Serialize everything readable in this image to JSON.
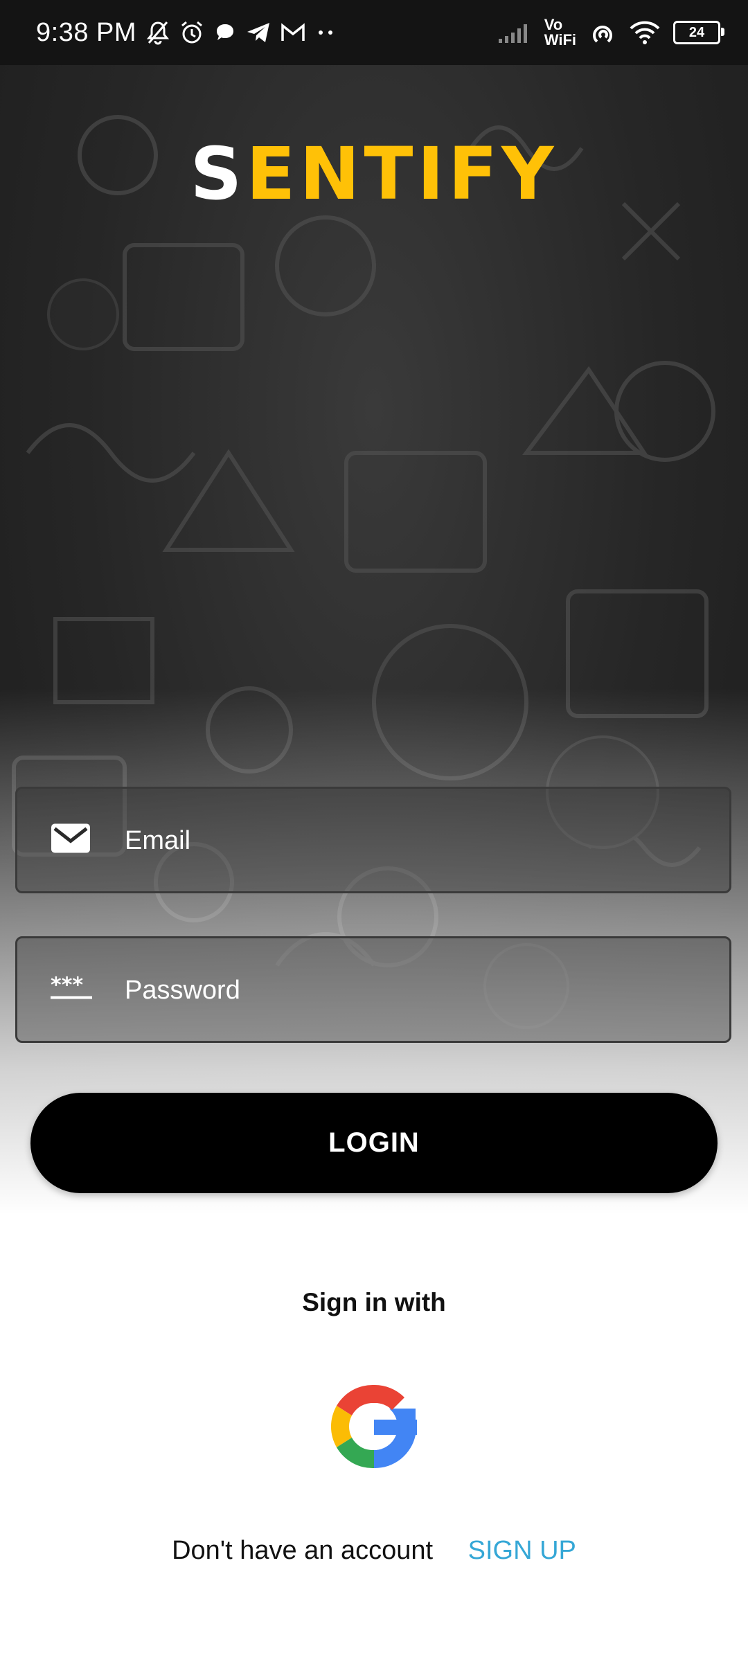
{
  "status_bar": {
    "time": "9:38 PM",
    "vo": "Vo",
    "wifi": "WiFi",
    "battery": "24"
  },
  "logo": {
    "first_letter": "S",
    "rest": "ENTIFY"
  },
  "email_field": {
    "placeholder": "Email",
    "icon": "mail-icon"
  },
  "password_field": {
    "placeholder": "Password",
    "icon": "password-dots-icon"
  },
  "login_button": {
    "label": "LOGIN"
  },
  "sign_in_with": "Sign in with",
  "google": {
    "icon": "google-icon"
  },
  "signup": {
    "prompt": "Don't have an account",
    "link": "SIGN UP"
  },
  "colors": {
    "accent": "#ffc107",
    "link": "#35a7d6",
    "button": "#000000",
    "status_bar": "#141414"
  }
}
